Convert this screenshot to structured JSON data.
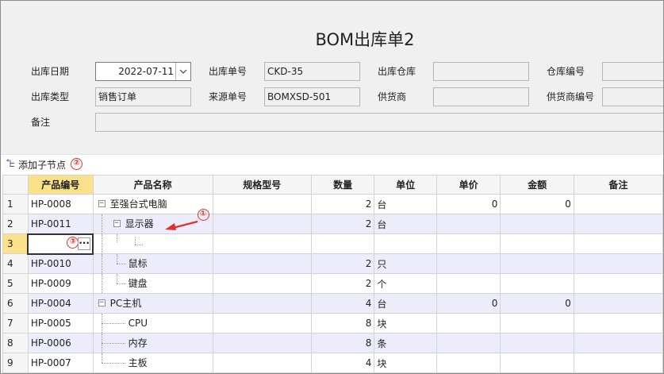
{
  "form": {
    "title": "BOM出库单2",
    "row1": {
      "out_date_label": "出库日期",
      "out_date_value": "2022-07-11",
      "out_no_label": "出库单号",
      "out_no_value": "CKD-35",
      "warehouse_label": "出库仓库",
      "warehouse_value": "",
      "warehouse_no_label": "仓库编号",
      "warehouse_no_value": ""
    },
    "row2": {
      "out_type_label": "出库类型",
      "out_type_value": "销售订单",
      "source_no_label": "来源单号",
      "source_no_value": "BOMXSD-501",
      "supplier_label": "供货商",
      "supplier_value": "",
      "supplier_no_label": "供货商编号",
      "supplier_no_value": ""
    },
    "row3": {
      "remark_label": "备注",
      "remark_value": ""
    }
  },
  "toolbar": {
    "add_child_label": "添加子节点",
    "add_child_icon": "add-child-node-icon"
  },
  "badges": {
    "one": "①",
    "two": "②",
    "three": "③"
  },
  "grid": {
    "columns": [
      "产品编号",
      "产品名称",
      "规格型号",
      "数量",
      "单位",
      "单价",
      "金额",
      "备注"
    ],
    "rows": [
      {
        "n": "1",
        "code": "HP-0008",
        "name": "至强台式电脑",
        "spec": "",
        "qty": "2",
        "unit": "台",
        "price": "0",
        "amount": "0",
        "remark": ""
      },
      {
        "n": "2",
        "code": "HP-0011",
        "name": "显示器",
        "spec": "",
        "qty": "2",
        "unit": "台",
        "price": "",
        "amount": "",
        "remark": ""
      },
      {
        "n": "3",
        "code": "",
        "name": "",
        "spec": "",
        "qty": "",
        "unit": "",
        "price": "",
        "amount": "",
        "remark": ""
      },
      {
        "n": "4",
        "code": "HP-0010",
        "name": "鼠标",
        "spec": "",
        "qty": "2",
        "unit": "只",
        "price": "",
        "amount": "",
        "remark": ""
      },
      {
        "n": "5",
        "code": "HP-0009",
        "name": "键盘",
        "spec": "",
        "qty": "2",
        "unit": "个",
        "price": "",
        "amount": "",
        "remark": ""
      },
      {
        "n": "6",
        "code": "HP-0004",
        "name": "PC主机",
        "spec": "",
        "qty": "4",
        "unit": "台",
        "price": "0",
        "amount": "0",
        "remark": ""
      },
      {
        "n": "7",
        "code": "HP-0005",
        "name": "CPU",
        "spec": "",
        "qty": "8",
        "unit": "块",
        "price": "",
        "amount": "",
        "remark": ""
      },
      {
        "n": "8",
        "code": "HP-0006",
        "name": "内存",
        "spec": "",
        "qty": "8",
        "unit": "条",
        "price": "",
        "amount": "",
        "remark": ""
      },
      {
        "n": "9",
        "code": "HP-0007",
        "name": "主板",
        "spec": "",
        "qty": "4",
        "unit": "块",
        "price": "",
        "amount": "",
        "remark": ""
      }
    ],
    "ellipsis_label": "···"
  },
  "colors": {
    "form_bg": "#f0f0f0",
    "active_header": "#fbe28a",
    "alt_row": "#ececfa",
    "annotation_red": "#e23030"
  }
}
